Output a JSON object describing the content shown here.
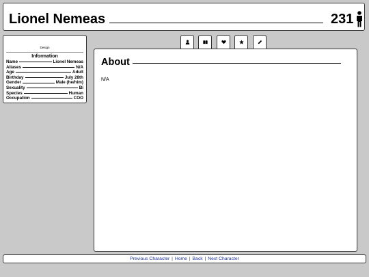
{
  "header": {
    "name": "Lionel Nemeas",
    "number": "231"
  },
  "sidebar": {
    "design_label": "Design",
    "info_title": "Information",
    "rows": [
      {
        "label": "Name",
        "value": "Lionel Nemeas"
      },
      {
        "label": "Aliases",
        "value": "N/A"
      },
      {
        "label": "Age",
        "value": "Adult"
      },
      {
        "label": "Birthday",
        "value": "July 28th"
      },
      {
        "label": "Gender",
        "value": "Male (he/him)"
      },
      {
        "label": "Sexuality",
        "value": "Bi"
      },
      {
        "label": "Species",
        "value": "Human"
      },
      {
        "label": "Occupation",
        "value": "COO"
      }
    ]
  },
  "tabs": [
    {
      "icon": "person-icon"
    },
    {
      "icon": "book-icon"
    },
    {
      "icon": "heart-icon"
    },
    {
      "icon": "star-icon"
    },
    {
      "icon": "pencil-icon"
    }
  ],
  "main": {
    "title": "About",
    "body": "N/A"
  },
  "footer": {
    "previous": "Previous Character",
    "home": "Home",
    "back": "Back",
    "next": "Next Character",
    "divider": "|"
  },
  "colors": {
    "background": "#c9c9c9",
    "panel": "#ffffff",
    "link": "#1a2fa0"
  }
}
